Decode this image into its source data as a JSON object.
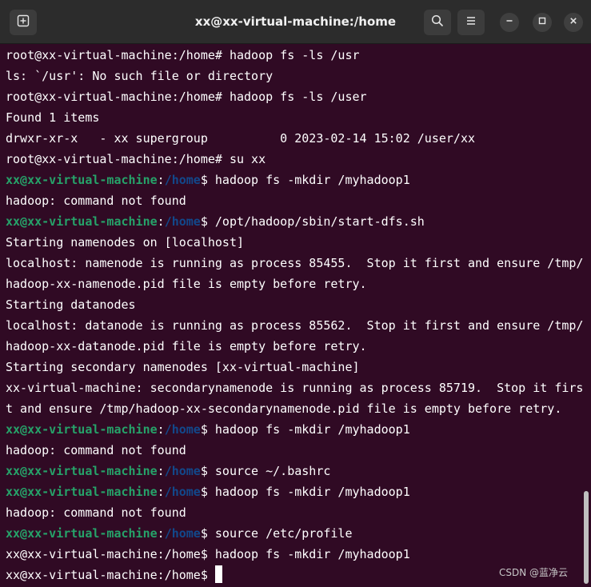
{
  "window": {
    "title": "xx@xx-virtual-machine:/home"
  },
  "titlebar": {
    "icons": {
      "new_tab": "new-tab-icon",
      "search": "search-icon",
      "menu": "hamburger-menu-icon",
      "minimize": "minimize-icon",
      "maximize": "maximize-icon",
      "close": "close-icon"
    }
  },
  "colors": {
    "background": "#300a24",
    "prompt_user": "#26a269",
    "prompt_path": "#12488b",
    "text": "#ffffff"
  },
  "terminal": {
    "lines": [
      {
        "text": "root@xx-virtual-machine:/home# hadoop fs -ls /usr"
      },
      {
        "text": "ls: `/usr': No such file or directory"
      },
      {
        "text": "root@xx-virtual-machine:/home# hadoop fs -ls /user"
      },
      {
        "text": "Found 1 items"
      },
      {
        "text": "drwxr-xr-x   - xx supergroup          0 2023-02-14 15:02 /user/xx"
      },
      {
        "text": "root@xx-virtual-machine:/home# su xx"
      },
      {
        "user": "xx@xx-virtual-machine",
        "sep": ":",
        "path": "/home",
        "text": "$ hadoop fs -mkdir /myhadoop1"
      },
      {
        "text": "hadoop: command not found"
      },
      {
        "user": "xx@xx-virtual-machine",
        "sep": ":",
        "path": "/home",
        "text": "$ /opt/hadoop/sbin/start-dfs.sh"
      },
      {
        "text": "Starting namenodes on [localhost]"
      },
      {
        "text": "localhost: namenode is running as process 85455.  Stop it first and ensure /tmp/"
      },
      {
        "text": "hadoop-xx-namenode.pid file is empty before retry."
      },
      {
        "text": "Starting datanodes"
      },
      {
        "text": "localhost: datanode is running as process 85562.  Stop it first and ensure /tmp/"
      },
      {
        "text": "hadoop-xx-datanode.pid file is empty before retry."
      },
      {
        "text": "Starting secondary namenodes [xx-virtual-machine]"
      },
      {
        "text": "xx-virtual-machine: secondarynamenode is running as process 85719.  Stop it firs"
      },
      {
        "text": "t and ensure /tmp/hadoop-xx-secondarynamenode.pid file is empty before retry."
      },
      {
        "user": "xx@xx-virtual-machine",
        "sep": ":",
        "path": "/home",
        "text": "$ hadoop fs -mkdir /myhadoop1"
      },
      {
        "text": "hadoop: command not found"
      },
      {
        "user": "xx@xx-virtual-machine",
        "sep": ":",
        "path": "/home",
        "text": "$ source ~/.bashrc"
      },
      {
        "user": "xx@xx-virtual-machine",
        "sep": ":",
        "path": "/home",
        "text": "$ hadoop fs -mkdir /myhadoop1"
      },
      {
        "text": "hadoop: command not found"
      },
      {
        "user": "xx@xx-virtual-machine",
        "sep": ":",
        "path": "/home",
        "text": "$ source /etc/profile"
      },
      {
        "text": "xx@xx-virtual-machine:/home$ hadoop fs -mkdir /myhadoop1"
      },
      {
        "text": "xx@xx-virtual-machine:/home$ ",
        "cursor": true
      }
    ]
  },
  "watermark": "CSDN @蓝净云"
}
